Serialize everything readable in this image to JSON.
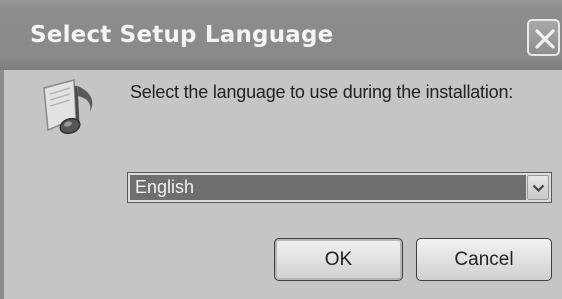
{
  "window": {
    "title": "Select Setup Language"
  },
  "icons": {
    "close": "close-icon",
    "setup": "music-note-icon",
    "dropdown": "chevron-down-icon"
  },
  "dialog": {
    "prompt": "Select the language to use during the installation:",
    "language_select": {
      "selected": "English"
    },
    "ok_label": "OK",
    "cancel_label": "Cancel"
  }
}
